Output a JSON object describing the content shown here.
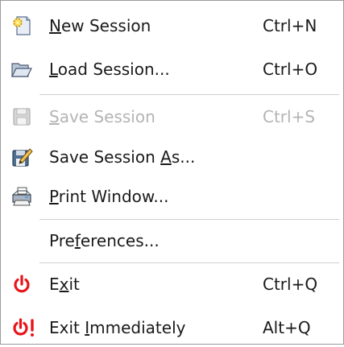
{
  "menu": {
    "items": [
      {
        "id": "new-session",
        "pre": "",
        "mnemonic": "N",
        "post": "ew Session",
        "accel": "Ctrl+N",
        "icon": "new-session-icon"
      },
      {
        "id": "load-session",
        "pre": "",
        "mnemonic": "L",
        "post": "oad Session...",
        "accel": "Ctrl+O",
        "icon": "folder-open-icon"
      },
      {
        "id": "save-session",
        "pre": "",
        "mnemonic": "S",
        "post": "ave Session",
        "accel": "Ctrl+S",
        "icon": "floppy-disk-icon",
        "disabled": true
      },
      {
        "id": "save-session-as",
        "pre": "Save Session ",
        "mnemonic": "A",
        "post": "s...",
        "accel": "",
        "icon": "save-as-icon"
      },
      {
        "id": "print-window",
        "pre": "",
        "mnemonic": "P",
        "post": "rint Window...",
        "accel": "",
        "icon": "printer-icon"
      },
      {
        "id": "preferences",
        "pre": "Pre",
        "mnemonic": "f",
        "post": "erences...",
        "accel": "",
        "icon": ""
      },
      {
        "id": "exit",
        "pre": "E",
        "mnemonic": "x",
        "post": "it",
        "accel": "Ctrl+Q",
        "icon": "power-icon"
      },
      {
        "id": "exit-immediately",
        "pre": "Exit ",
        "mnemonic": "I",
        "post": "mmediately",
        "accel": "Alt+Q",
        "icon": "power-exclaim-icon"
      }
    ]
  },
  "colors": {
    "power_red": "#e8141b",
    "disabled_text": "#b4b4b4",
    "separator": "#cfcfcf"
  }
}
